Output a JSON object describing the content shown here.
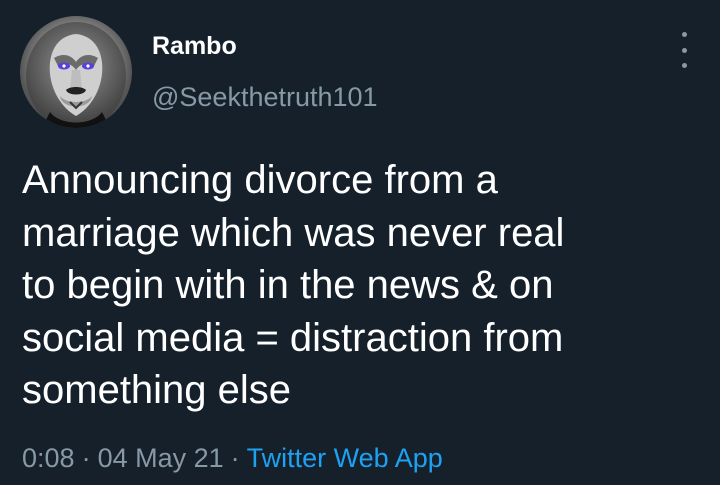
{
  "user": {
    "display_name": "Rambo",
    "handle": "@Seekthetruth101"
  },
  "tweet": {
    "lines": [
      "Announcing divorce from a",
      "marriage which was never real",
      "to begin with in the news & on",
      "social media = distraction from",
      "something else"
    ]
  },
  "meta": {
    "time": "0:08",
    "separator": "·",
    "date": "04 May 21",
    "source": "Twitter Web App"
  },
  "icons": {
    "avatar": "lion-avatar-icon",
    "more": "more-vertical-icon"
  },
  "colors": {
    "background": "#15202b",
    "text": "#ffffff",
    "secondary": "#8899a6",
    "link": "#1da1f2"
  }
}
